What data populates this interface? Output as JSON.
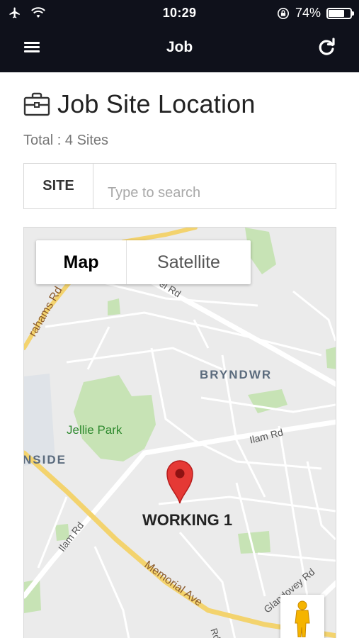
{
  "status_bar": {
    "time": "10:29",
    "battery_pct": "74%",
    "battery_level": 0.74
  },
  "header": {
    "title": "Job",
    "menu_icon": "hamburger-menu-icon",
    "refresh_icon": "refresh-icon"
  },
  "page": {
    "icon": "briefcase-icon",
    "title": "Job Site Location",
    "total": "Total : 4 Sites"
  },
  "search": {
    "label": "SITE",
    "placeholder": "Type to search",
    "value": ""
  },
  "map": {
    "map_type": {
      "map_label": "Map",
      "satellite_label": "Satellite",
      "selected": "Map"
    },
    "pin_label": "WORKING 1",
    "place_labels": {
      "bryndwr": "BRYNDWR",
      "jellie_park": "Jellie Park",
      "inside": "NSIDE",
      "grahams_rd": "rahams Rd",
      "el_rd": "el Rd",
      "ilam_rd_right": "Ilam Rd",
      "ilam_rd_left": "Ilam Rd",
      "memorial_ave": "Memorial Ave",
      "glandovey_rd": "Glandovey Rd",
      "road_p": "Rd"
    }
  }
}
